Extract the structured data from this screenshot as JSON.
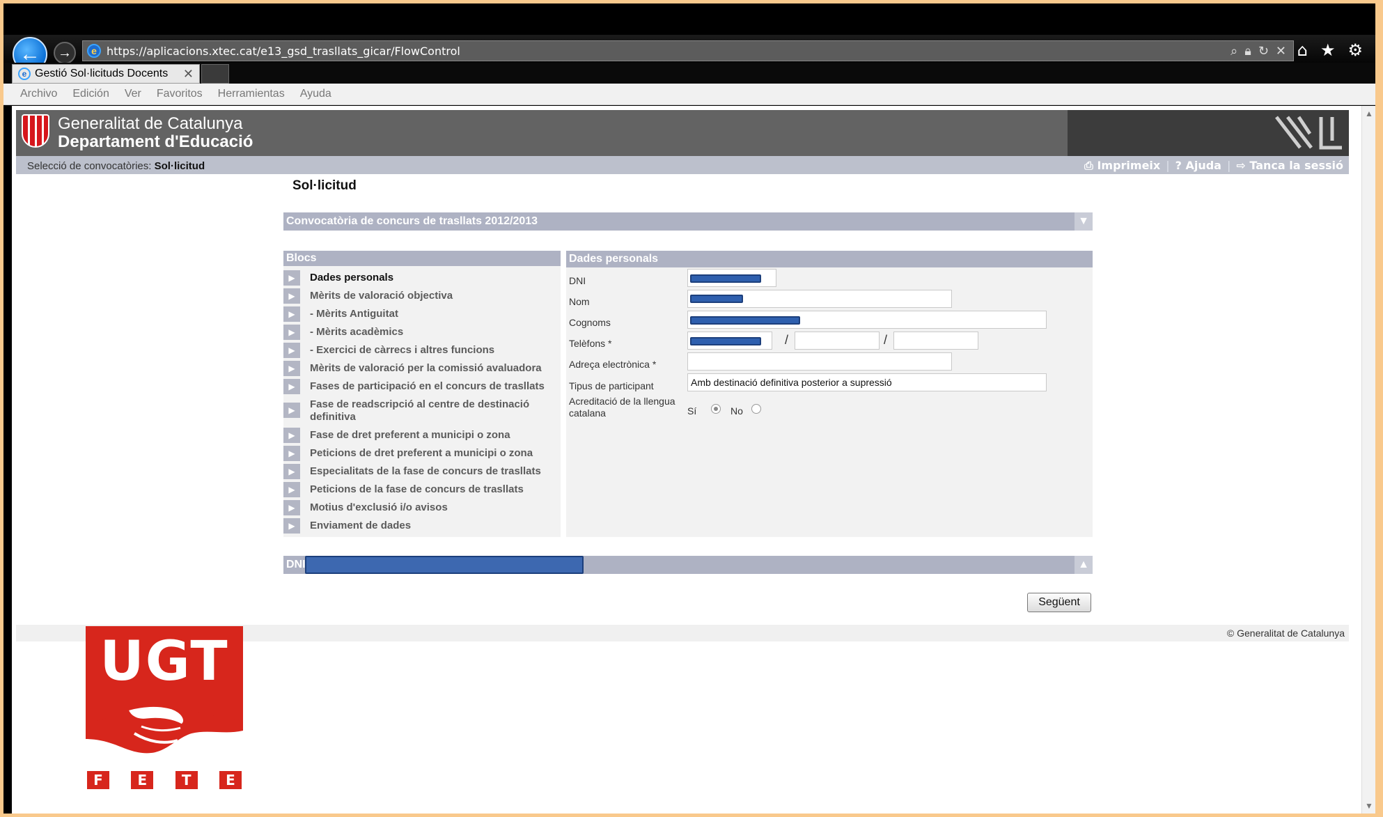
{
  "browser": {
    "url": "https://aplicacions.xtec.cat/e13_gsd_trasllats_gicar/FlowControl",
    "tab_title": "Gestió Sol·licituds Docents",
    "menu": [
      "Archivo",
      "Edición",
      "Ver",
      "Favoritos",
      "Herramientas",
      "Ayuda"
    ]
  },
  "header": {
    "org_line1": "Generalitat de Catalunya",
    "org_line2": "Departament d'Educació",
    "breadcrumb_prefix": "Selecció de convocatòries:",
    "breadcrumb_current": "Sol·licitud",
    "links": {
      "print": "Imprimeix",
      "help": "Ajuda",
      "logout": "Tanca la sessió"
    }
  },
  "page": {
    "title": "Sol·licitud",
    "convocatoria": "Convocatòria de concurs de trasllats 2012/2013",
    "blocs_title": "Blocs",
    "blocs": [
      "Dades personals",
      "Mèrits de valoració objectiva",
      "- Mèrits Antiguitat",
      "- Mèrits acadèmics",
      "- Exercici de càrrecs i altres funcions",
      "Mèrits de valoració per la comissió avaluadora",
      "Fases de participació en el concurs de trasllats",
      "Fase de readscripció al centre de destinació definitiva",
      "Fase de dret preferent a municipi o zona",
      "Peticions de dret preferent a municipi o zona",
      "Especialitats de la fase de concurs de trasllats",
      "Peticions de la fase de concurs de trasllats",
      "Motius d'exclusió i/o avisos",
      "Enviament de dades"
    ],
    "dades_title": "Dades personals",
    "fields": {
      "dni": "DNI",
      "nom": "Nom",
      "cognoms": "Cognoms",
      "telefons": "Telèfons *",
      "email": "Adreça electrònica *",
      "tipus": "Tipus de participant",
      "tipus_value": "Amb destinació definitiva posterior a supressió",
      "llengua": "Acreditació de la llengua catalana",
      "si": "Sí",
      "no": "No"
    },
    "llengua_selected": "Sí",
    "dni_bar": "DNI",
    "next_button": "Següent",
    "copyright": "© Generalitat de Catalunya"
  },
  "logo": {
    "ugt": "UGT",
    "fete": [
      "F",
      "E",
      "T",
      "E"
    ]
  },
  "colors": {
    "bar": "#aeb2c3",
    "panel": "#f2f2f2",
    "header": "#636363",
    "ugt_red": "#d7261c",
    "redaction": "#2e5fae"
  }
}
